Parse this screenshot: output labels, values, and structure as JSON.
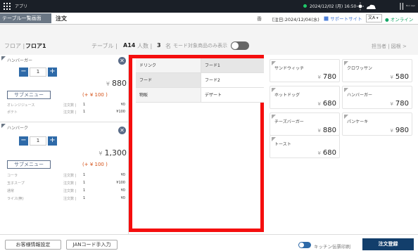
{
  "app": {
    "title": "アプリ"
  },
  "topbar": {
    "datetime": "2024/12/02 (月) 16:50",
    "logo": "Bon Lapi"
  },
  "header": {
    "table_list": "テーブル一覧画面",
    "order": "注文",
    "star": "番",
    "order_date": "[注日:2024/12/04(水)",
    "support": "サポートサイト",
    "lang": "文A",
    "online": "● オンライン"
  },
  "floorbar": {
    "floor_label": "フロア |",
    "floor_value": "フロア1",
    "table_label": "テーブル |",
    "table_value": "A14",
    "people_label": "人数 |",
    "people_value": "3",
    "people_unit": "名",
    "mode_label": "モード対象商品のみ表示",
    "staff": "担当者 | 図根 >"
  },
  "orders": [
    {
      "name": "ハンバーガー",
      "qty": "1",
      "yen": "¥",
      "price": "880",
      "submenu_label": "サブメニュー",
      "submenu_total": "(+ ¥ 100 )",
      "subs": [
        {
          "name": "オレンジジュース",
          "qty_label": "注文数 |",
          "qty": "1",
          "price": "¥0"
        },
        {
          "name": "ポテト",
          "qty_label": "注文数 |",
          "qty": "1",
          "price": "¥100"
        }
      ]
    },
    {
      "name": "ハンバーク",
      "qty": "1",
      "yen": "¥",
      "price": "1,300",
      "submenu_label": "サブメニュー",
      "submenu_total": "(+ ¥ 100 )",
      "subs": [
        {
          "name": "コーラ",
          "qty_label": "注文数 |",
          "qty": "1",
          "price": "¥0"
        },
        {
          "name": "玉子スープ",
          "qty_label": "注文数 |",
          "qty": "1",
          "price": "¥100"
        },
        {
          "name": "通常",
          "qty_label": "注文数 |",
          "qty": "1",
          "price": "¥0"
        },
        {
          "name": "ライス(無)",
          "qty_label": "注文数 |",
          "qty": "1",
          "price": "¥0"
        }
      ]
    }
  ],
  "categories": {
    "left": [
      "ドリンク",
      "フード",
      "物販"
    ],
    "right": [
      "フード1",
      "フード2",
      "デザート"
    ]
  },
  "products": [
    {
      "name": "サンドウィッチ",
      "price": "780"
    },
    {
      "name": "クロワッサン",
      "price": "580"
    },
    {
      "name": "ホットドッグ",
      "price": "680"
    },
    {
      "name": "ハンバーガー",
      "price": "780"
    },
    {
      "name": "チーズバーガー",
      "price": "880"
    },
    {
      "name": "パンケーキ",
      "price": "980"
    },
    {
      "name": "トースト",
      "price": "680"
    }
  ],
  "yen": "¥",
  "bottom": {
    "customer": "お客様情報設定",
    "jan": "JANコード手入力",
    "kitchen": "キッチン伝票印刷",
    "submit": "注文登録"
  },
  "colors": {
    "accent": "#123e6b",
    "highlight": "#f50e0e",
    "online": "#13a566",
    "discount": "#d44f15"
  }
}
